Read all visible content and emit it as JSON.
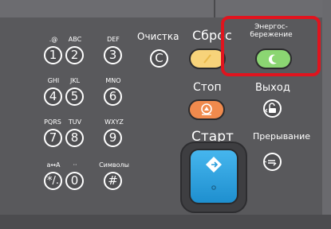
{
  "keypad": {
    "k1": {
      "digit": "1",
      "sub": ".@"
    },
    "k2": {
      "digit": "2",
      "sub": "ABC"
    },
    "k3": {
      "digit": "3",
      "sub": "DEF"
    },
    "k4": {
      "digit": "4",
      "sub": "GHI"
    },
    "k5": {
      "digit": "5",
      "sub": "JKL"
    },
    "k6": {
      "digit": "6",
      "sub": "MNO"
    },
    "k7": {
      "digit": "7",
      "sub": "PQRS"
    },
    "k8": {
      "digit": "8",
      "sub": "TUV"
    },
    "k9": {
      "digit": "9",
      "sub": "WXYZ"
    },
    "star": {
      "digit": "*/.",
      "sub": "a↔A"
    },
    "k0": {
      "digit": "0",
      "sub": "··"
    },
    "hash": {
      "digit": "#",
      "sub": "Символы"
    }
  },
  "clear": {
    "label": "Очистка",
    "key": "C"
  },
  "reset": {
    "label": "Сброс",
    "color": "#f7d37a"
  },
  "energy": {
    "line1": "Энергос-",
    "line2": "бережение",
    "color": "#8bd672"
  },
  "stop": {
    "label": "Стоп",
    "color": "#f08a4d"
  },
  "logout": {
    "label": "Выход"
  },
  "start": {
    "label": "Старт",
    "color": "#2e9fdc"
  },
  "interrupt": {
    "label": "Прерывание"
  },
  "highlight_color": "#e0141e"
}
